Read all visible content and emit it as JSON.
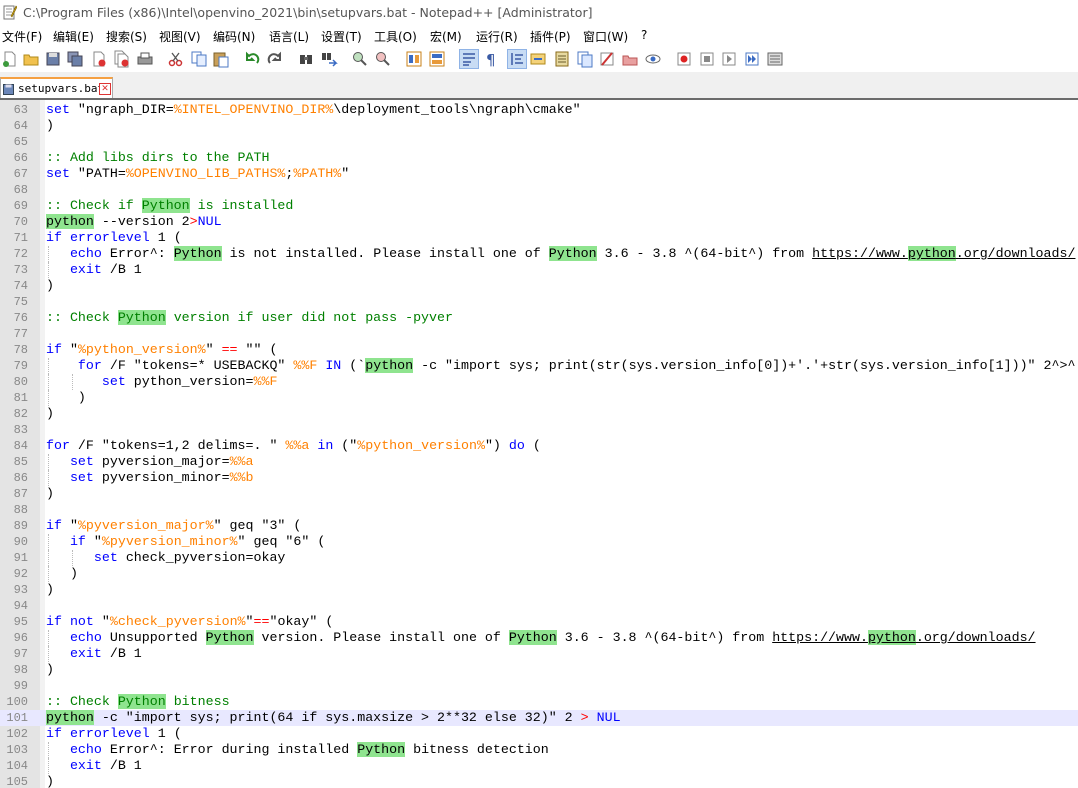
{
  "window": {
    "title": "C:\\Program Files (x86)\\Intel\\openvino_2021\\bin\\setupvars.bat - Notepad++ [Administrator]"
  },
  "menu": [
    "文件(F)",
    "编辑(E)",
    "搜索(S)",
    "视图(V)",
    "编码(N)",
    "语言(L)",
    "设置(T)",
    "工具(O)",
    "宏(M)",
    "运行(R)",
    "插件(P)",
    "窗口(W)",
    "?"
  ],
  "toolbar_icons": [
    "new-file-icon",
    "open-file-icon",
    "save-icon",
    "save-all-icon",
    "close-icon",
    "close-all-icon",
    "print-icon",
    "cut-icon",
    "copy-icon",
    "paste-icon",
    "undo-icon",
    "redo-icon",
    "find-icon",
    "replace-icon",
    "zoom-in-icon",
    "zoom-out-icon",
    "sync-vertical-icon",
    "sync-horizontal-icon",
    "word-wrap-icon",
    "show-all-chars-icon",
    "indent-guide-icon",
    "udl-icon",
    "doc-map-icon",
    "function-list-icon",
    "folder-workspace-icon",
    "monitor-icon",
    "record-macro-icon",
    "stop-record-icon",
    "play-macro-icon",
    "run-macro-multiple-icon",
    "save-macro-icon"
  ],
  "tab": {
    "label": "setupvars.bat"
  },
  "colors": {
    "keyword": "#0000ff",
    "comment": "#008000",
    "variable": "#ff8000",
    "operator": "#ff0000",
    "highlight": "#8fe48f",
    "current_line": "#e8e8ff"
  },
  "lines": [
    {
      "n": "63",
      "guides": [],
      "t": [
        [
          "set",
          "k"
        ],
        [
          " \"ngraph_DIR=",
          ""
        ],
        [
          "%INTEL_OPENVINO_DIR%",
          "v"
        ],
        [
          "\\deployment_tools\\ngraph\\cmake\"",
          ""
        ]
      ]
    },
    {
      "n": "64",
      "guides": [],
      "t": [
        [
          ")",
          ""
        ]
      ]
    },
    {
      "n": "65",
      "guides": [],
      "t": []
    },
    {
      "n": "66",
      "guides": [],
      "t": [
        [
          ":: Add libs dirs to the PATH",
          "c"
        ]
      ]
    },
    {
      "n": "67",
      "guides": [],
      "t": [
        [
          "set",
          "k"
        ],
        [
          " \"PATH=",
          ""
        ],
        [
          "%OPENVINO_LIB_PATHS%",
          "v"
        ],
        [
          ";",
          ""
        ],
        [
          "%PATH%",
          "v"
        ],
        [
          "\"",
          ""
        ]
      ]
    },
    {
      "n": "68",
      "guides": [],
      "t": []
    },
    {
      "n": "69",
      "guides": [],
      "t": [
        [
          ":: Check if ",
          "c"
        ],
        [
          "Python",
          "c hl"
        ],
        [
          " is installed",
          "c"
        ]
      ]
    },
    {
      "n": "70",
      "guides": [],
      "t": [
        [
          "python",
          "hl"
        ],
        [
          " --version 2",
          ""
        ],
        [
          ">",
          "o"
        ],
        [
          "NUL",
          "k"
        ]
      ]
    },
    {
      "n": "71",
      "guides": [],
      "t": [
        [
          "if",
          "k"
        ],
        [
          " ",
          ""
        ],
        [
          "errorlevel",
          "k"
        ],
        [
          " 1 (",
          ""
        ]
      ]
    },
    {
      "n": "72",
      "guides": [
        0
      ],
      "t": [
        [
          "   ",
          ""
        ],
        [
          "echo",
          "k"
        ],
        [
          " Error^: ",
          ""
        ],
        [
          "Python",
          "hl"
        ],
        [
          " is not installed. Please install one of ",
          ""
        ],
        [
          "Python",
          "hl"
        ],
        [
          " 3.6 - 3.8 ^(64-bit^) from ",
          ""
        ],
        [
          "https://www.",
          "u"
        ],
        [
          "python",
          "u hl"
        ],
        [
          ".org/downloads/",
          "u"
        ]
      ]
    },
    {
      "n": "73",
      "guides": [
        0
      ],
      "t": [
        [
          "   ",
          ""
        ],
        [
          "exit",
          "k"
        ],
        [
          " /B 1",
          ""
        ]
      ]
    },
    {
      "n": "74",
      "guides": [],
      "t": [
        [
          ")",
          ""
        ]
      ]
    },
    {
      "n": "75",
      "guides": [],
      "t": []
    },
    {
      "n": "76",
      "guides": [],
      "t": [
        [
          ":: Check ",
          "c"
        ],
        [
          "Python",
          "c hl"
        ],
        [
          " version if user did not pass -pyver",
          "c"
        ]
      ]
    },
    {
      "n": "77",
      "guides": [],
      "t": []
    },
    {
      "n": "78",
      "guides": [],
      "t": [
        [
          "if",
          "k"
        ],
        [
          " \"",
          ""
        ],
        [
          "%python_version%",
          "v"
        ],
        [
          "\" ",
          ""
        ],
        [
          "==",
          "o"
        ],
        [
          " \"\" (",
          ""
        ]
      ]
    },
    {
      "n": "79",
      "guides": [
        0
      ],
      "t": [
        [
          "    ",
          ""
        ],
        [
          "for",
          "k"
        ],
        [
          " /F \"tokens=* USEBACKQ\" ",
          ""
        ],
        [
          "%%F",
          "v"
        ],
        [
          " ",
          ""
        ],
        [
          "IN",
          "k"
        ],
        [
          " (`",
          ""
        ],
        [
          "python",
          "hl"
        ],
        [
          " -c \"import sys; print(str(sys.version_info[0])+'.'+str(sys.version_info[1]))\" 2^>^",
          ""
        ]
      ]
    },
    {
      "n": "80",
      "guides": [
        0,
        1
      ],
      "t": [
        [
          "       ",
          ""
        ],
        [
          "set",
          "k"
        ],
        [
          " python_version=",
          ""
        ],
        [
          "%%F",
          "v"
        ]
      ]
    },
    {
      "n": "81",
      "guides": [
        0
      ],
      "t": [
        [
          "    )",
          ""
        ]
      ]
    },
    {
      "n": "82",
      "guides": [],
      "t": [
        [
          ")",
          ""
        ]
      ]
    },
    {
      "n": "83",
      "guides": [],
      "t": []
    },
    {
      "n": "84",
      "guides": [],
      "t": [
        [
          "for",
          "k"
        ],
        [
          " /F \"tokens=1,2 delims=. \" ",
          ""
        ],
        [
          "%%a",
          "v"
        ],
        [
          " ",
          ""
        ],
        [
          "in",
          "k"
        ],
        [
          " (\"",
          ""
        ],
        [
          "%python_version%",
          "v"
        ],
        [
          "\") ",
          ""
        ],
        [
          "do",
          "k"
        ],
        [
          " (",
          ""
        ]
      ]
    },
    {
      "n": "85",
      "guides": [
        0
      ],
      "t": [
        [
          "   ",
          ""
        ],
        [
          "set",
          "k"
        ],
        [
          " pyversion_major=",
          ""
        ],
        [
          "%%a",
          "v"
        ]
      ]
    },
    {
      "n": "86",
      "guides": [
        0
      ],
      "t": [
        [
          "   ",
          ""
        ],
        [
          "set",
          "k"
        ],
        [
          " pyversion_minor=",
          ""
        ],
        [
          "%%b",
          "v"
        ]
      ]
    },
    {
      "n": "87",
      "guides": [],
      "t": [
        [
          ")",
          ""
        ]
      ]
    },
    {
      "n": "88",
      "guides": [],
      "t": []
    },
    {
      "n": "89",
      "guides": [],
      "t": [
        [
          "if",
          "k"
        ],
        [
          " \"",
          ""
        ],
        [
          "%pyversion_major%",
          "v"
        ],
        [
          "\" geq \"3\" (",
          ""
        ]
      ]
    },
    {
      "n": "90",
      "guides": [
        0
      ],
      "t": [
        [
          "   ",
          ""
        ],
        [
          "if",
          "k"
        ],
        [
          " \"",
          ""
        ],
        [
          "%pyversion_minor%",
          "v"
        ],
        [
          "\" geq \"6\" (",
          ""
        ]
      ]
    },
    {
      "n": "91",
      "guides": [
        0,
        1
      ],
      "t": [
        [
          "      ",
          ""
        ],
        [
          "set",
          "k"
        ],
        [
          " check_pyversion=okay",
          ""
        ]
      ]
    },
    {
      "n": "92",
      "guides": [
        0
      ],
      "t": [
        [
          "   )",
          ""
        ]
      ]
    },
    {
      "n": "93",
      "guides": [],
      "t": [
        [
          ")",
          ""
        ]
      ]
    },
    {
      "n": "94",
      "guides": [],
      "t": []
    },
    {
      "n": "95",
      "guides": [],
      "t": [
        [
          "if",
          "k"
        ],
        [
          " ",
          ""
        ],
        [
          "not",
          "k"
        ],
        [
          " \"",
          ""
        ],
        [
          "%check_pyversion%",
          "v"
        ],
        [
          "\"",
          ""
        ],
        [
          "==",
          "o"
        ],
        [
          "\"okay\" (",
          ""
        ]
      ]
    },
    {
      "n": "96",
      "guides": [
        0
      ],
      "t": [
        [
          "   ",
          ""
        ],
        [
          "echo",
          "k"
        ],
        [
          " Unsupported ",
          ""
        ],
        [
          "Python",
          "hl"
        ],
        [
          " version. Please install one of ",
          ""
        ],
        [
          "Python",
          "hl"
        ],
        [
          " 3.6 - 3.8 ^(64-bit^) from ",
          ""
        ],
        [
          "https://www.",
          "u"
        ],
        [
          "python",
          "u hl"
        ],
        [
          ".org/downloads/",
          "u"
        ]
      ]
    },
    {
      "n": "97",
      "guides": [
        0
      ],
      "t": [
        [
          "   ",
          ""
        ],
        [
          "exit",
          "k"
        ],
        [
          " /B 1",
          ""
        ]
      ]
    },
    {
      "n": "98",
      "guides": [],
      "t": [
        [
          ")",
          ""
        ]
      ]
    },
    {
      "n": "99",
      "guides": [],
      "t": []
    },
    {
      "n": "100",
      "guides": [],
      "t": [
        [
          ":: Check ",
          "c"
        ],
        [
          "Python",
          "c hl"
        ],
        [
          " bitness",
          "c"
        ]
      ]
    },
    {
      "n": "101",
      "guides": [],
      "cur": true,
      "t": [
        [
          "python",
          "hl"
        ],
        [
          " -c \"import sys; print(64 if sys.maxsize > 2**32 else 32)\" 2 ",
          ""
        ],
        [
          ">",
          "o"
        ],
        [
          " ",
          ""
        ],
        [
          "NUL",
          "k"
        ]
      ]
    },
    {
      "n": "102",
      "guides": [],
      "t": [
        [
          "if",
          "k"
        ],
        [
          " ",
          ""
        ],
        [
          "errorlevel",
          "k"
        ],
        [
          " 1 (",
          ""
        ]
      ]
    },
    {
      "n": "103",
      "guides": [
        0
      ],
      "t": [
        [
          "   ",
          ""
        ],
        [
          "echo",
          "k"
        ],
        [
          " Error^: Error during installed ",
          ""
        ],
        [
          "Python",
          "hl"
        ],
        [
          " bitness detection",
          ""
        ]
      ]
    },
    {
      "n": "104",
      "guides": [
        0
      ],
      "t": [
        [
          "   ",
          ""
        ],
        [
          "exit",
          "k"
        ],
        [
          " /B 1",
          ""
        ]
      ]
    },
    {
      "n": "105",
      "guides": [],
      "t": [
        [
          ")",
          ""
        ]
      ]
    }
  ]
}
